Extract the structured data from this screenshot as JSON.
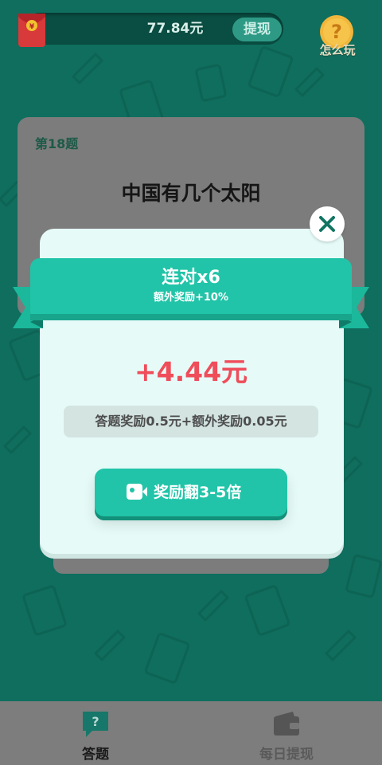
{
  "top_bar": {
    "balance": "77.84元",
    "withdraw_label": "提现",
    "howto_label": "怎么玩"
  },
  "question_card": {
    "number_label": "第18题",
    "question": "中国有几个太阳"
  },
  "reward_modal": {
    "streak_title": "连对x6",
    "bonus_subtitle": "额外奖励+10%",
    "amount": "+4.44元",
    "breakdown": "答题奖励0.5元+额外奖励0.05元",
    "multiply_button": "奖励翻3-5倍"
  },
  "bottom_nav": {
    "items": [
      {
        "label": "答题",
        "icon": "question-bubble-icon",
        "active": true
      },
      {
        "label": "每日提现",
        "icon": "wallet-icon",
        "active": false
      }
    ]
  },
  "colors": {
    "background": "#0f6e5e",
    "accent": "#21c4a8",
    "reward_red": "#ef4d5a",
    "modal_bg": "#e6fbf8"
  }
}
